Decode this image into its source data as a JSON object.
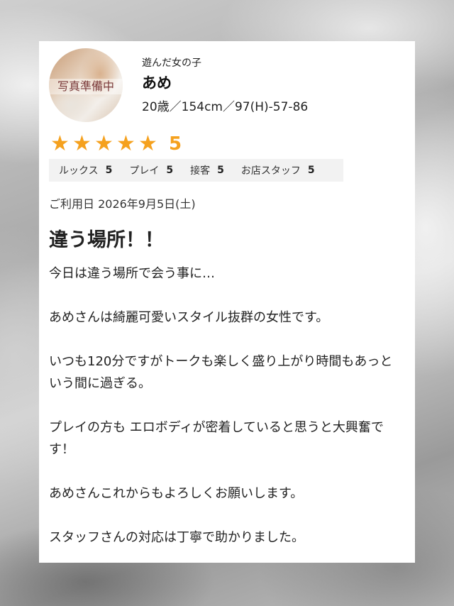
{
  "girl": {
    "avatar_label": "写真準備中",
    "caption": "遊んだ女の子",
    "name": "あめ",
    "specs": "20歳／154cm／97(H)-57-86"
  },
  "rating": {
    "stars": 5,
    "star_glyph": "★",
    "overall": "5",
    "star_color": "#f5a11e",
    "items": [
      {
        "label": "ルックス",
        "value": "5"
      },
      {
        "label": "プレイ",
        "value": "5"
      },
      {
        "label": "接客",
        "value": "5"
      },
      {
        "label": "お店スタッフ",
        "value": "5"
      }
    ]
  },
  "review": {
    "visit_date": "ご利用日 2026年9月5日(土)",
    "title": "違う場所！！",
    "paragraphs": [
      "今日は違う場所で会う事に…",
      "あめさんは綺麗可愛いスタイル抜群の女性です。",
      "いつも120分ですがトークも楽しく盛り上がり時間もあっという間に過ぎる。",
      "プレイの方も エロボディが密着していると思うと大興奮です！",
      "あめさんこれからもよろしくお願いします。",
      "スタッフさんの対応は丁寧で助かりました。"
    ]
  }
}
